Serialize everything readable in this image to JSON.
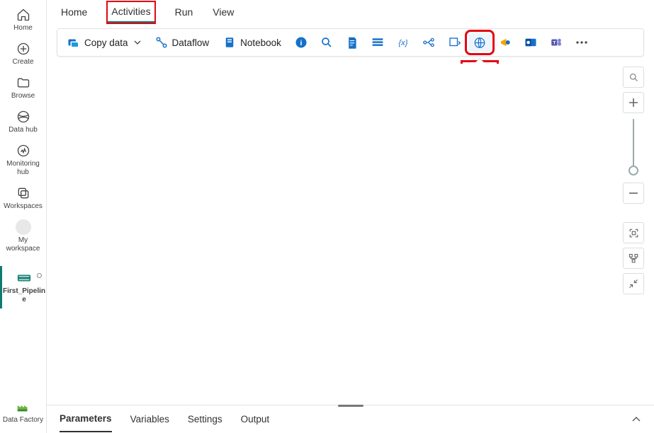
{
  "rail": {
    "home": "Home",
    "create": "Create",
    "browse": "Browse",
    "datahub": "Data hub",
    "monitoring": "Monitoring hub",
    "workspaces": "Workspaces",
    "my_workspace": "My workspace",
    "pipeline": "First_Pipeline",
    "product": "Data Factory"
  },
  "tabs": {
    "home": "Home",
    "activities": "Activities",
    "run": "Run",
    "view": "View"
  },
  "toolbar": {
    "copy_data": "Copy data",
    "dataflow": "Dataflow",
    "notebook": "Notebook",
    "web_tooltip": "Web"
  },
  "bottom": {
    "parameters": "Parameters",
    "variables": "Variables",
    "settings": "Settings",
    "output": "Output"
  }
}
